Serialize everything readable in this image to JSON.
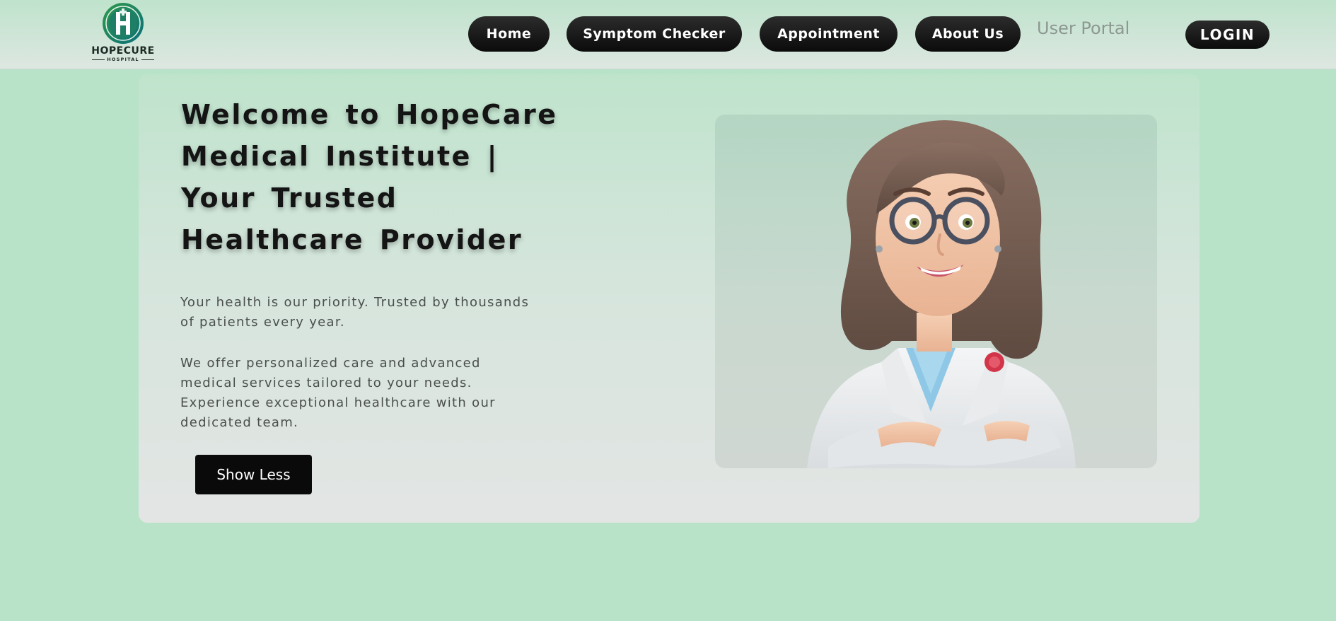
{
  "header": {
    "logo": {
      "emblem_icon": "hospital-h-emblem-icon",
      "name": "HOPECURE",
      "subtitle": "HOSPITAL"
    },
    "nav": [
      {
        "label": "Home"
      },
      {
        "label": "Symptom Checker"
      },
      {
        "label": "Appointment"
      },
      {
        "label": "About Us"
      }
    ],
    "user_portal_label": "User Portal",
    "login_label": "LOGIN"
  },
  "hero": {
    "title_lines": [
      "Welcome to HopeCare",
      "Medical Institute |",
      "Your Trusted",
      "Healthcare Provider"
    ],
    "paragraph_1": "Your health is our priority. Trusted by thousands of patients every year.",
    "paragraph_2": "We offer personalized care and advanced medical services tailored to your needs. Experience exceptional healthcare with our dedicated team.",
    "toggle_button_label": "Show Less",
    "image_icon": "doctor-illustration"
  },
  "colors": {
    "page_background": "#b8e3c8",
    "button_background": "#0b0b0b",
    "button_text": "#ffffff",
    "user_portal_text": "#8c9891",
    "title_text": "#141414",
    "body_text": "#4a4f4c"
  }
}
